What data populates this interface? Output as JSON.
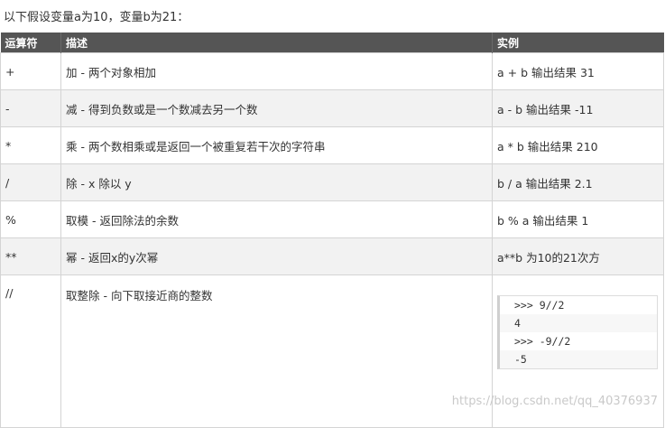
{
  "intro": "以下假设变量a为10，变量b为21：",
  "table": {
    "headers": [
      "运算符",
      "描述",
      "实例"
    ],
    "rows": [
      {
        "op": "+",
        "desc": "加 - 两个对象相加",
        "example": "a + b 输出结果 31"
      },
      {
        "op": "-",
        "desc": "减 - 得到负数或是一个数减去另一个数",
        "example": "a - b 输出结果 -11"
      },
      {
        "op": "*",
        "desc": "乘 - 两个数相乘或是返回一个被重复若干次的字符串",
        "example": "a * b 输出结果 210"
      },
      {
        "op": "/",
        "desc": "除 - x 除以 y",
        "example": "b / a 输出结果 2.1"
      },
      {
        "op": "%",
        "desc": "取模 - 返回除法的余数",
        "example": "b % a 输出结果 1"
      },
      {
        "op": "**",
        "desc": "幂 - 返回x的y次幂",
        "example": "a**b 为10的21次方"
      },
      {
        "op": "//",
        "desc": "取整除 - 向下取接近商的整数",
        "code": [
          ">>> 9//2",
          "4",
          ">>> -9//2",
          "-5"
        ]
      }
    ]
  },
  "watermark": "https://blog.csdn.net/qq_40376937"
}
